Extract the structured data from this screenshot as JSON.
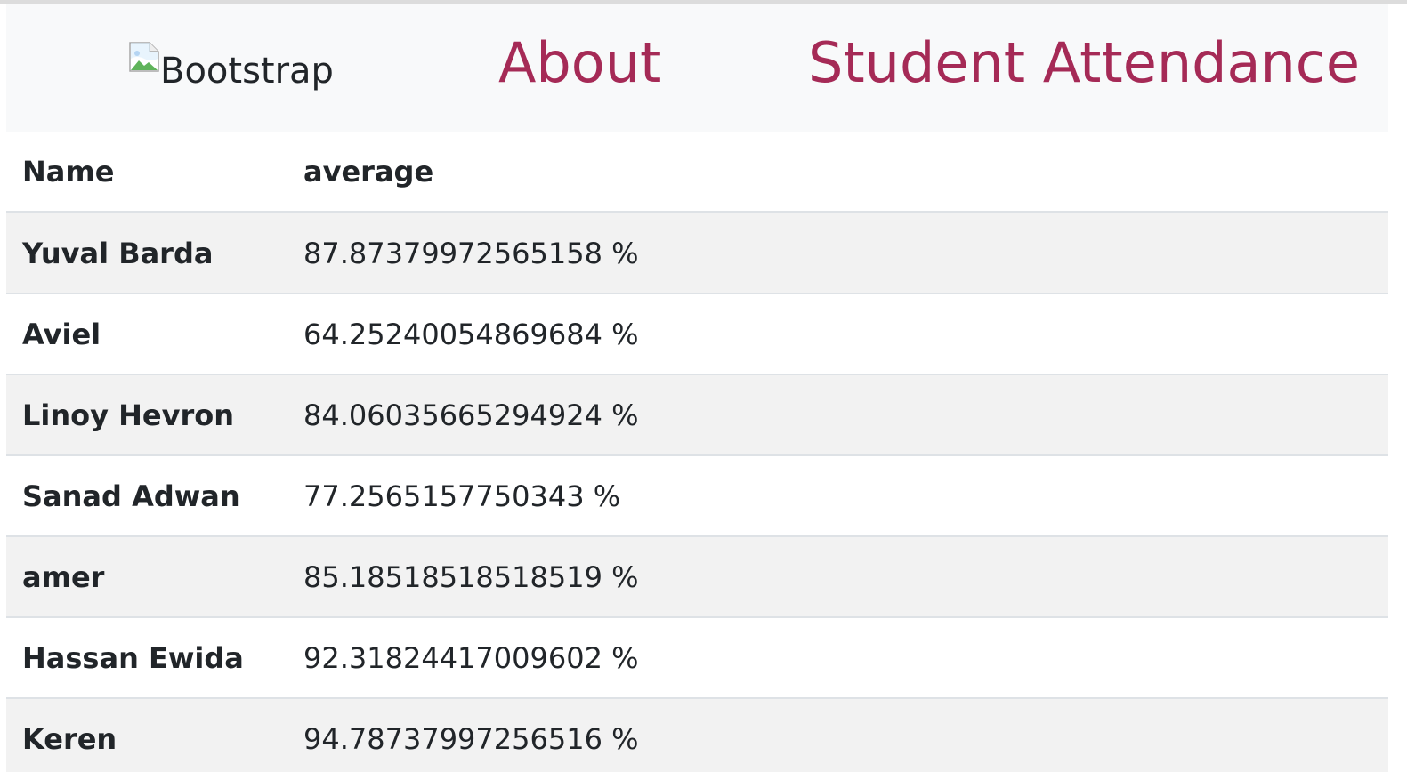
{
  "navbar": {
    "brand": {
      "alt_text": "Bootstrap",
      "icon": "broken-image-icon"
    },
    "links": [
      {
        "label": "About"
      },
      {
        "label": "Student Attendance"
      }
    ],
    "link_color": "#a52a56",
    "background": "#f8f9fa"
  },
  "table": {
    "headers": {
      "name": "Name",
      "average": "average"
    },
    "rows": [
      {
        "name": "Yuval Barda",
        "average": "87.87379972565158 %"
      },
      {
        "name": "Aviel",
        "average": "64.25240054869684 %"
      },
      {
        "name": "Linoy Hevron",
        "average": "84.06035665294924 %"
      },
      {
        "name": "Sanad Adwan",
        "average": "77.2565157750343 %"
      },
      {
        "name": "amer",
        "average": "85.18518518518519 %"
      },
      {
        "name": "Hassan Ewida",
        "average": "92.31824417009602 %"
      },
      {
        "name": "Keren",
        "average": "94.78737997256516 %"
      }
    ],
    "stripe_color": "#f2f2f2"
  }
}
